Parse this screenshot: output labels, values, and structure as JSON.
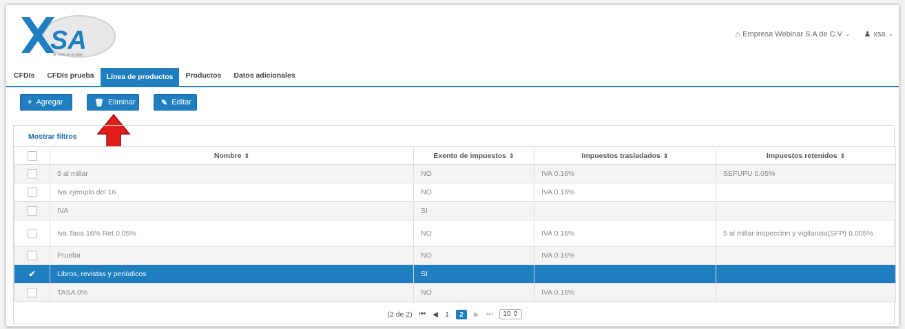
{
  "header": {
    "logo_text": "XSA",
    "logo_tagline": "Mi socio en la nube",
    "company": "Empresa Webinar S.A de C.V",
    "user": "xsa",
    "company_icon": "home-icon",
    "user_icon": "user-icon"
  },
  "tabs": [
    {
      "label": "CFDIs",
      "active": false
    },
    {
      "label": "CFDIs prueba",
      "active": false
    },
    {
      "label": "Línea de productos",
      "active": true
    },
    {
      "label": "Productos",
      "active": false
    },
    {
      "label": "Datos adicionales",
      "active": false
    }
  ],
  "toolbar": {
    "add_label": "Agregar",
    "delete_label": "Eliminar",
    "edit_label": "Editar"
  },
  "table": {
    "filters_label": "Mostrar filtros",
    "columns": [
      "Nombre",
      "Exento de impuestos",
      "Impuestos trasladados",
      "Impuestos retenidos"
    ],
    "rows": [
      {
        "nombre": "5 al millar",
        "exento": "NO",
        "trasladados": "IVA 0.16%",
        "retenidos": "SEFUPU 0.05%",
        "selected": false
      },
      {
        "nombre": "Iva ejemplo del 16",
        "exento": "NO",
        "trasladados": "IVA 0.16%",
        "retenidos": "",
        "selected": false
      },
      {
        "nombre": "IVA",
        "exento": "SI",
        "trasladados": "",
        "retenidos": "",
        "selected": false
      },
      {
        "nombre": "Iva Tasa 16% Ret 0.05%",
        "exento": "NO",
        "trasladados": "IVA 0.16%",
        "retenidos": "5 al millar inspeccion y vigilancia(SFP) 0.005%",
        "selected": false
      },
      {
        "nombre": "Prueba",
        "exento": "NO",
        "trasladados": "IVA 0.16%",
        "retenidos": "",
        "selected": false
      },
      {
        "nombre": "Libros, revistas y periódicos",
        "exento": "SI",
        "trasladados": "",
        "retenidos": "",
        "selected": true
      },
      {
        "nombre": "TASA 0%",
        "exento": "NO",
        "trasladados": "IVA 0.16%",
        "retenidos": "",
        "selected": false
      }
    ]
  },
  "pager": {
    "summary": "(2 de 2)",
    "pages": [
      "1",
      "2"
    ],
    "current_page": "2",
    "page_size": "10"
  },
  "colors": {
    "accent": "#1f7ec0",
    "arrow": "#e21b1b"
  }
}
